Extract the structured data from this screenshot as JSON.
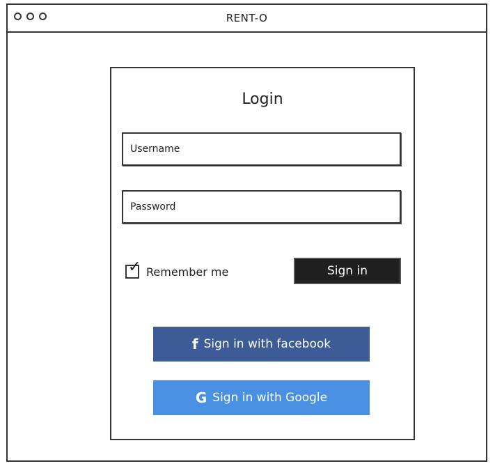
{
  "window": {
    "title": "RENT-O",
    "controls": [
      "circle-icon",
      "circle-icon",
      "circle-icon"
    ]
  },
  "login": {
    "heading": "Login",
    "username_placeholder": "Username",
    "password_placeholder": "Password",
    "remember_label": "Remember me",
    "remember_checked": true,
    "signin_label": "Sign in",
    "facebook": {
      "icon": "facebook-icon",
      "glyph": "f",
      "label": "Sign in with facebook",
      "color": "#3d5b96"
    },
    "google": {
      "icon": "google-icon",
      "glyph": "G",
      "label": "Sign in with Google",
      "color": "#4a90e2"
    }
  }
}
